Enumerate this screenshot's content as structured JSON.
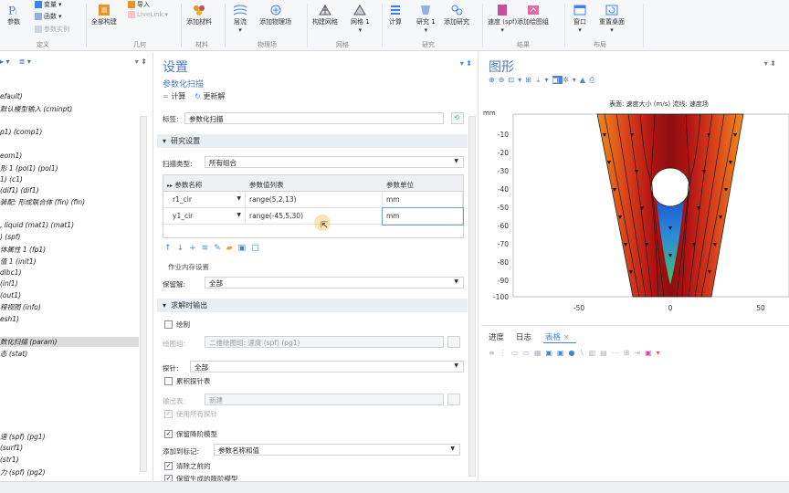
{
  "ribbon": {
    "buttons": [
      {
        "label": "参数",
        "icon": "parameters-icon"
      },
      {
        "label": "全部构建",
        "icon": "build-all-icon"
      },
      {
        "label": "添加材料",
        "icon": "add-material-icon"
      },
      {
        "label": "层流",
        "icon": "laminar-flow-icon"
      },
      {
        "label": "添加物理场",
        "icon": "add-physics-icon"
      },
      {
        "label": "构建网格",
        "icon": "build-mesh-icon"
      },
      {
        "label": "网格 1",
        "icon": "mesh-icon"
      },
      {
        "label": "计算",
        "icon": "compute-icon"
      },
      {
        "label": "研究 1",
        "icon": "study-icon"
      },
      {
        "label": "添加研究",
        "icon": "add-study-icon"
      },
      {
        "label": "速度 (spf)",
        "icon": "velocity-plot-icon"
      },
      {
        "label": "添加绘图组",
        "icon": "add-plot-group-icon"
      },
      {
        "label": "窗口",
        "icon": "windows-icon"
      },
      {
        "label": "重置桌面",
        "icon": "reset-desktop-icon"
      }
    ],
    "small_items": {
      "variables": "变量",
      "functions": "函数",
      "param_case": "参数实例",
      "import": "导入",
      "livelink": "LiveLink"
    },
    "groups": [
      "定义",
      "几何",
      "材料",
      "物理场",
      "网格",
      "研究",
      "结果",
      "布局"
    ]
  },
  "tree": {
    "items": [
      "efault)",
      "默认模型输入 (cminpt)",
      "p1) (comp1)",
      "eom1)",
      "形 1 (pol1) (pol1)",
      "1) (c1)",
      "(dif1) (dif1)",
      "装配: 形成联合体 (fin) (fin)",
      ", liquid (mat1) (mat1)",
      ") (spf)",
      "体属性 1 (fp1)",
      "值 1 (init1)",
      "dlbc1)",
      "(inl1)",
      "(out1)",
      "程视图 (info)",
      "esh1)",
      "数化扫描 (param)",
      "态 (stat)",
      "速 (spf) (pg1)",
      "(surf1)",
      "(str1)",
      "力 (spf) (pg2)"
    ]
  },
  "settings": {
    "title": "设置",
    "subtitle": "参数化扫描",
    "compute": "计算",
    "update": "更新解",
    "label_caption": "标签:",
    "label_value": "参数化扫描",
    "section_study": "研究设置",
    "sweep_type_label": "扫描类型:",
    "sweep_type_value": "所有组合",
    "table_headers": [
      "参数名称",
      "参数值列表",
      "参数单位"
    ],
    "table_rows": [
      {
        "name": "r1_cir",
        "values": "range(5,2,13)",
        "unit": "mm"
      },
      {
        "name": "y1_cir",
        "values": "range(-45,5,30)",
        "unit": "mm"
      }
    ],
    "memory_label": "作业内存设置",
    "keep_solution_label": "保留解:",
    "keep_solution_value": "全部",
    "section_output": "求解时输出",
    "plot_label": "绘制",
    "plot_group_label": "绘图组:",
    "plot_group_value": "二维绘图组: 速度 (spf) (pg1)",
    "probe_label": "探针:",
    "probe_value": "全部",
    "accum_table_label": "累积探针表",
    "output_table_label": "输出表:",
    "output_table_value": "新建",
    "use_all_probes": "使用所有探针",
    "keep_model_label": "保留降阶模型",
    "add_to_label": "添加到标记:",
    "add_to_value": "参数名称和值",
    "clear_previous": "清除之前的",
    "keep_generated": "保留生成的降阶模型"
  },
  "graphics": {
    "title": "图形",
    "caption": "表面: 速度大小 (m/s)  流线: 速度场",
    "y_unit": "mm",
    "y_ticks": [
      "-10",
      "-20",
      "-30",
      "-40",
      "-50",
      "-60",
      "-70",
      "-80",
      "-90",
      "-100"
    ],
    "x_ticks": [
      "-50",
      "0",
      "50"
    ]
  },
  "bottom": {
    "tabs": [
      "进度",
      "日志",
      "表格"
    ]
  },
  "colors": {
    "accent": "#4a7cc0",
    "selection": "#dcdcdc",
    "section_bg": "#e9eef5"
  }
}
